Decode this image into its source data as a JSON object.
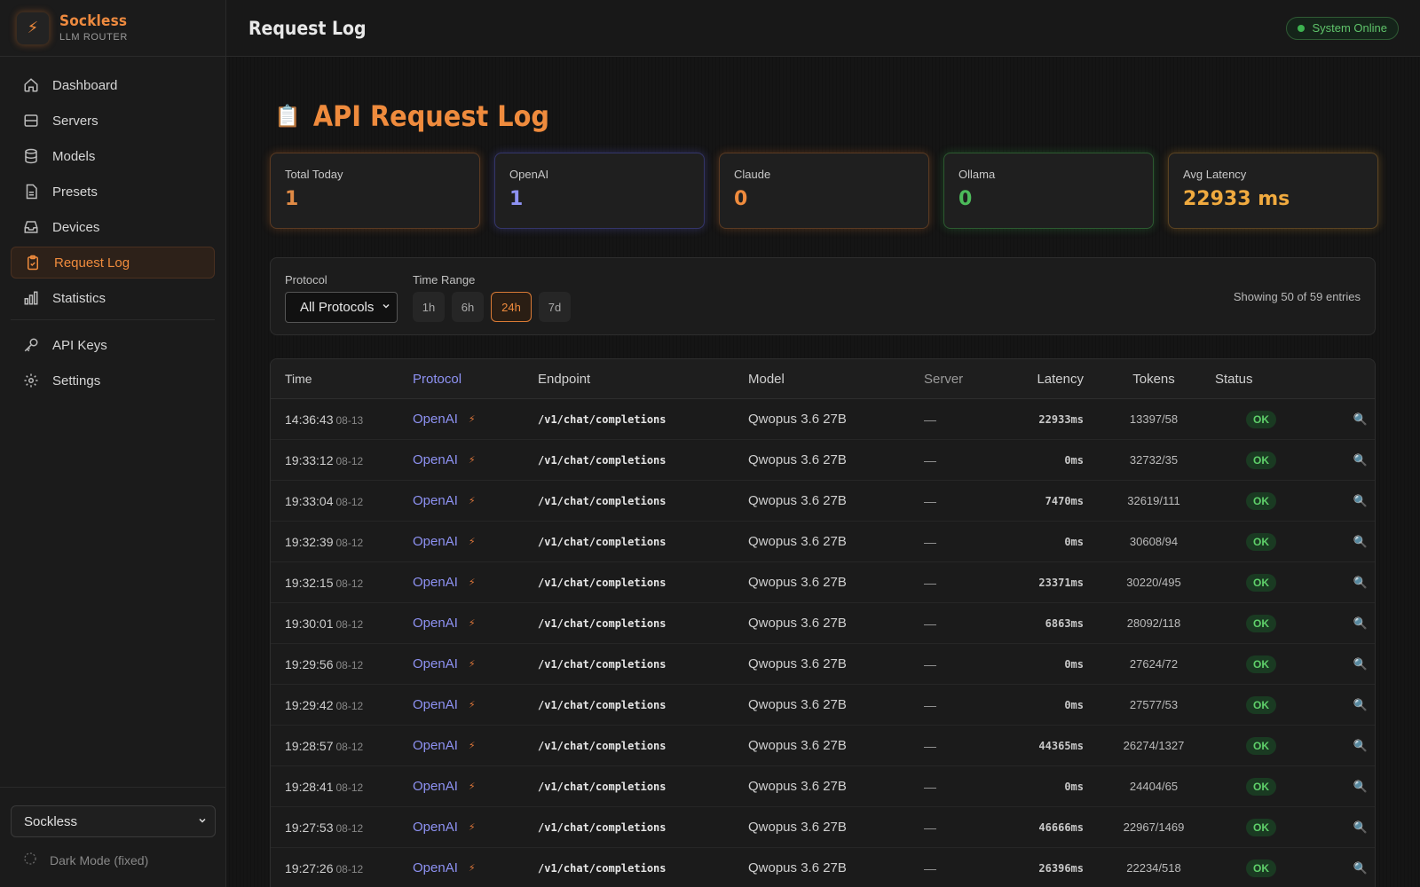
{
  "brand": {
    "name": "Sockless",
    "subtitle": "LLM ROUTER",
    "logo_icon": "lightning-icon"
  },
  "sidebar": {
    "items": [
      {
        "label": "Dashboard",
        "icon": "home-icon"
      },
      {
        "label": "Servers",
        "icon": "server-icon"
      },
      {
        "label": "Models",
        "icon": "database-icon"
      },
      {
        "label": "Presets",
        "icon": "document-icon"
      },
      {
        "label": "Devices",
        "icon": "inbox-icon"
      },
      {
        "label": "Request Log",
        "icon": "clipboard-icon",
        "active": true
      },
      {
        "label": "Statistics",
        "icon": "bar-chart-icon"
      },
      {
        "label": "API Keys",
        "icon": "key-icon"
      },
      {
        "label": "Settings",
        "icon": "gear-icon"
      }
    ],
    "server_select": "Sockless",
    "dark_mode_label": "Dark Mode (fixed)"
  },
  "header": {
    "title": "Request Log",
    "status": "System Online"
  },
  "page": {
    "title": "API Request Log",
    "title_icon": "clipboard-emoji-icon"
  },
  "cards": [
    {
      "label": "Total Today",
      "value": "1"
    },
    {
      "label": "OpenAI",
      "value": "1"
    },
    {
      "label": "Claude",
      "value": "0"
    },
    {
      "label": "Ollama",
      "value": "0"
    },
    {
      "label": "Avg Latency",
      "value": "22933 ms"
    }
  ],
  "filters": {
    "protocol_label": "Protocol",
    "protocol_value": "All Protocols",
    "time_range_label": "Time Range",
    "ranges": [
      "1h",
      "6h",
      "24h",
      "7d"
    ],
    "active_range": "24h",
    "showing": "Showing 50 of 59 entries"
  },
  "table": {
    "headers": [
      "Time",
      "Protocol",
      "Endpoint",
      "Model",
      "Server",
      "Latency",
      "Tokens",
      "Status"
    ],
    "rows": [
      {
        "time": "14:36:43",
        "date": "08-13",
        "protocol": "OpenAI",
        "endpoint": "/v1/chat/completions",
        "model": "Qwopus 3.6 27B",
        "server": "—",
        "latency": "22933ms",
        "tokens": "13397/58",
        "status": "OK"
      },
      {
        "time": "19:33:12",
        "date": "08-12",
        "protocol": "OpenAI",
        "endpoint": "/v1/chat/completions",
        "model": "Qwopus 3.6 27B",
        "server": "—",
        "latency": "0ms",
        "tokens": "32732/35",
        "status": "OK"
      },
      {
        "time": "19:33:04",
        "date": "08-12",
        "protocol": "OpenAI",
        "endpoint": "/v1/chat/completions",
        "model": "Qwopus 3.6 27B",
        "server": "—",
        "latency": "7470ms",
        "tokens": "32619/111",
        "status": "OK"
      },
      {
        "time": "19:32:39",
        "date": "08-12",
        "protocol": "OpenAI",
        "endpoint": "/v1/chat/completions",
        "model": "Qwopus 3.6 27B",
        "server": "—",
        "latency": "0ms",
        "tokens": "30608/94",
        "status": "OK"
      },
      {
        "time": "19:32:15",
        "date": "08-12",
        "protocol": "OpenAI",
        "endpoint": "/v1/chat/completions",
        "model": "Qwopus 3.6 27B",
        "server": "—",
        "latency": "23371ms",
        "tokens": "30220/495",
        "status": "OK"
      },
      {
        "time": "19:30:01",
        "date": "08-12",
        "protocol": "OpenAI",
        "endpoint": "/v1/chat/completions",
        "model": "Qwopus 3.6 27B",
        "server": "—",
        "latency": "6863ms",
        "tokens": "28092/118",
        "status": "OK"
      },
      {
        "time": "19:29:56",
        "date": "08-12",
        "protocol": "OpenAI",
        "endpoint": "/v1/chat/completions",
        "model": "Qwopus 3.6 27B",
        "server": "—",
        "latency": "0ms",
        "tokens": "27624/72",
        "status": "OK"
      },
      {
        "time": "19:29:42",
        "date": "08-12",
        "protocol": "OpenAI",
        "endpoint": "/v1/chat/completions",
        "model": "Qwopus 3.6 27B",
        "server": "—",
        "latency": "0ms",
        "tokens": "27577/53",
        "status": "OK"
      },
      {
        "time": "19:28:57",
        "date": "08-12",
        "protocol": "OpenAI",
        "endpoint": "/v1/chat/completions",
        "model": "Qwopus 3.6 27B",
        "server": "—",
        "latency": "44365ms",
        "tokens": "26274/1327",
        "status": "OK"
      },
      {
        "time": "19:28:41",
        "date": "08-12",
        "protocol": "OpenAI",
        "endpoint": "/v1/chat/completions",
        "model": "Qwopus 3.6 27B",
        "server": "—",
        "latency": "0ms",
        "tokens": "24404/65",
        "status": "OK"
      },
      {
        "time": "19:27:53",
        "date": "08-12",
        "protocol": "OpenAI",
        "endpoint": "/v1/chat/completions",
        "model": "Qwopus 3.6 27B",
        "server": "—",
        "latency": "46666ms",
        "tokens": "22967/1469",
        "status": "OK"
      },
      {
        "time": "19:27:26",
        "date": "08-12",
        "protocol": "OpenAI",
        "endpoint": "/v1/chat/completions",
        "model": "Qwopus 3.6 27B",
        "server": "—",
        "latency": "26396ms",
        "tokens": "22234/518",
        "status": "OK"
      }
    ]
  },
  "colors": {
    "accent": "#ef8b3d",
    "openai": "#8e92f3",
    "ok": "#5fd06a"
  }
}
